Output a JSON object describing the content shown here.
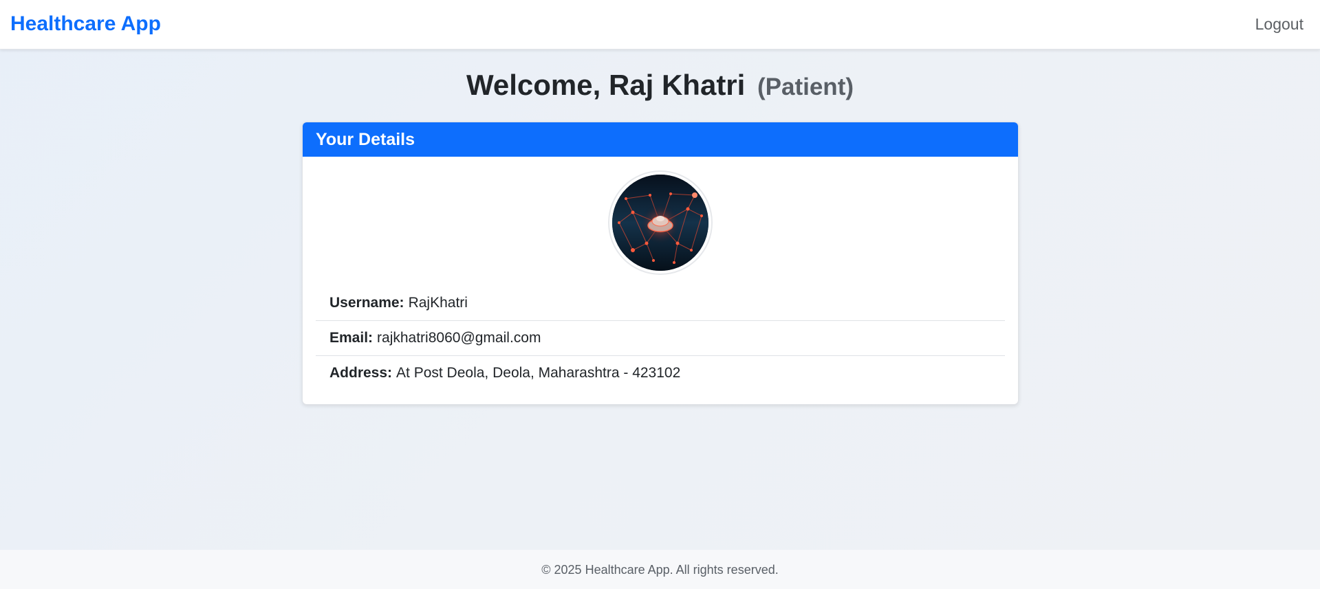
{
  "navbar": {
    "brand": "Healthcare App",
    "logout_label": "Logout"
  },
  "welcome": {
    "prefix": "Welcome, ",
    "name": "Raj Khatri",
    "role": "(Patient)"
  },
  "details_card": {
    "header": "Your Details",
    "avatar_alt": "profile-picture",
    "fields": [
      {
        "label": "Username:",
        "value": "RajKhatri"
      },
      {
        "label": "Email:",
        "value": "rajkhatri8060@gmail.com"
      },
      {
        "label": "Address:",
        "value": "At Post Deola, Deola, Maharashtra - 423102"
      }
    ]
  },
  "footer": {
    "text": "© 2025 Healthcare App. All rights reserved."
  },
  "colors": {
    "primary": "#0d6efd",
    "text": "#212529",
    "muted": "#595f66"
  }
}
